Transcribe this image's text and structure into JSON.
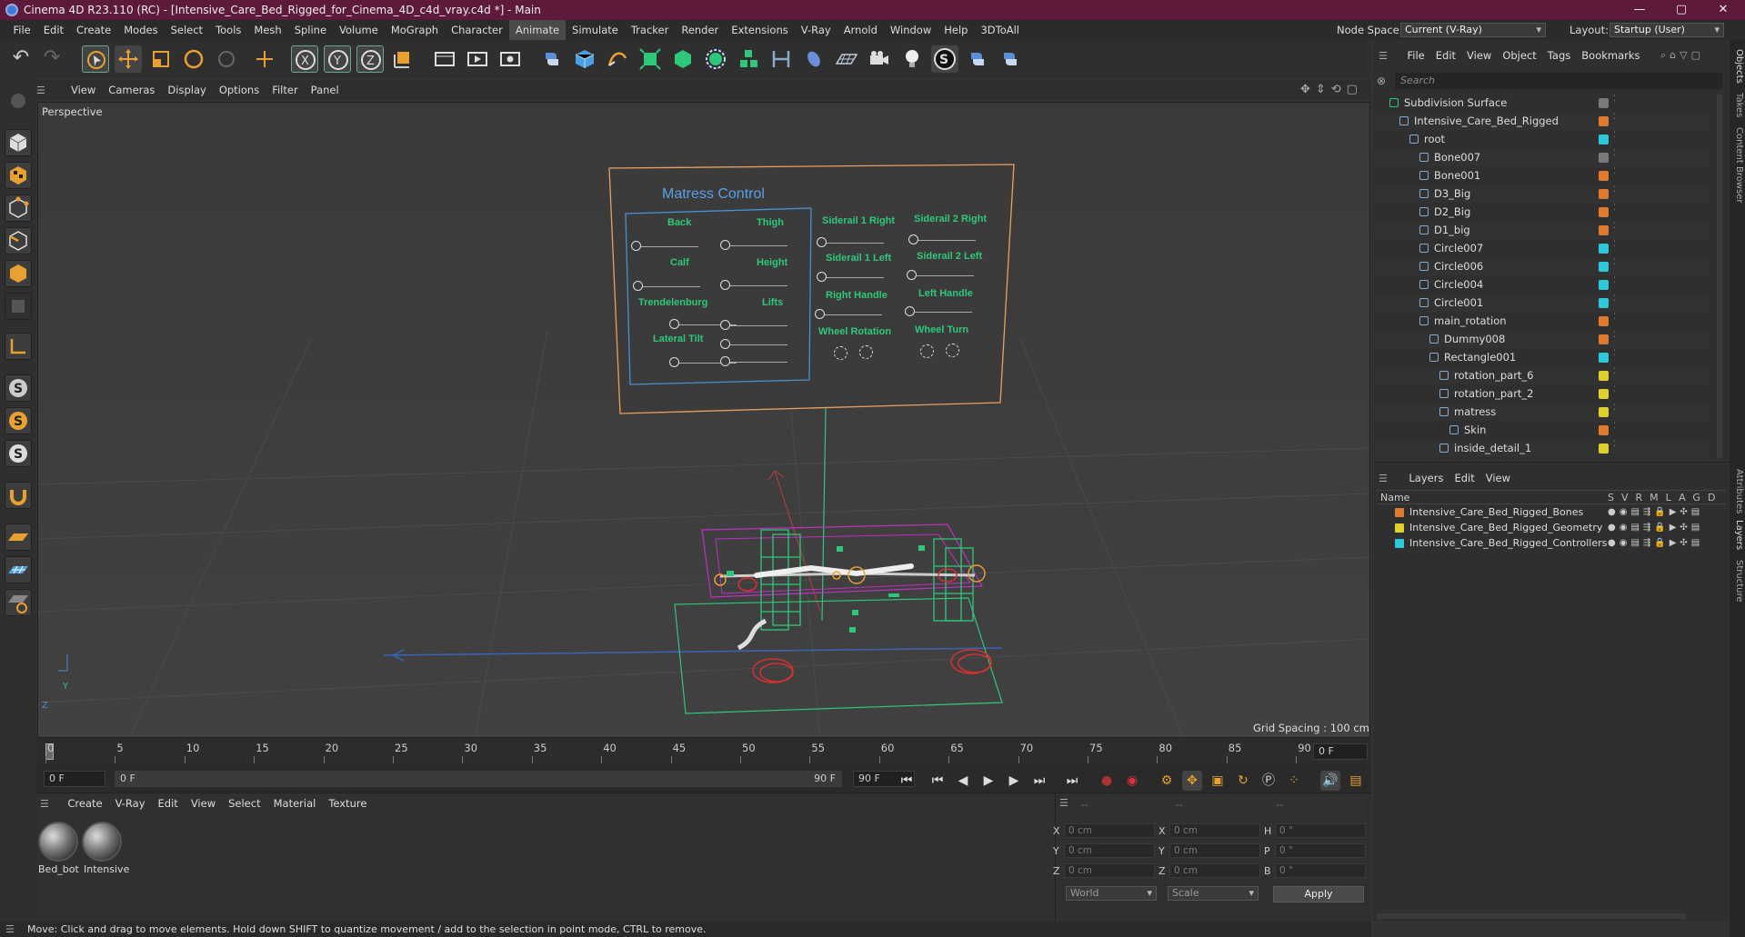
{
  "titlebar": {
    "title": "Cinema 4D R23.110 (RC) - [Intensive_Care_Bed_Rigged_for_Cinema_4D_c4d_vray.c4d *] - Main",
    "minimize": "—",
    "maximize": "▢",
    "close": "✕"
  },
  "menubar": {
    "items": [
      "File",
      "Edit",
      "Create",
      "Modes",
      "Select",
      "Tools",
      "Mesh",
      "Spline",
      "Volume",
      "MoGraph",
      "Character",
      "Animate",
      "Simulate",
      "Tracker",
      "Render",
      "Extensions",
      "V-Ray",
      "Arnold",
      "Window",
      "Help",
      "3DToAll"
    ],
    "active": "Animate",
    "node_space_label": "Node Space:",
    "node_space_value": "Current (V-Ray)",
    "layout_label": "Layout:",
    "layout_value": "Startup (User)"
  },
  "viewport": {
    "menu": [
      "View",
      "Cameras",
      "Display",
      "Options",
      "Filter",
      "Panel"
    ],
    "label": "Perspective",
    "grid_spacing": "Grid Spacing : 100 cm",
    "axis_y": "Y",
    "axis_z": "Z",
    "hud": {
      "title": "Matress Control",
      "left_sliders": [
        "Back",
        "Thigh",
        "Calf",
        "Height",
        "Trendelenburg",
        "Lifts",
        "Lateral Tilt"
      ],
      "right_sliders": [
        "Siderail 1 Right",
        "Siderail 2 Right",
        "Siderail 1 Left",
        "Siderail 2 Left",
        "Right Handle",
        "Left Handle",
        "Wheel Rotation",
        "Wheel Turn"
      ]
    }
  },
  "timeline": {
    "ticks": [
      "0",
      "5",
      "10",
      "15",
      "20",
      "25",
      "30",
      "35",
      "40",
      "45",
      "50",
      "55",
      "60",
      "65",
      "70",
      "75",
      "80",
      "85",
      "90"
    ],
    "current_frame": "0 F"
  },
  "playback": {
    "start": "0 F",
    "range_start": "0 F",
    "range_end": "90 F",
    "end": "90 F"
  },
  "materials": {
    "menu": [
      "Create",
      "V-Ray",
      "Edit",
      "View",
      "Select",
      "Material",
      "Texture"
    ],
    "items": [
      "Bed_bot",
      "Intensive"
    ]
  },
  "coordinates": {
    "headers": [
      "--",
      "--",
      "--"
    ],
    "rows": [
      {
        "a": "X",
        "av": "0 cm",
        "b": "X",
        "bv": "0 cm",
        "c": "H",
        "cv": "0 °"
      },
      {
        "a": "Y",
        "av": "0 cm",
        "b": "Y",
        "bv": "0 cm",
        "c": "P",
        "cv": "0 °"
      },
      {
        "a": "Z",
        "av": "0 cm",
        "b": "Z",
        "bv": "0 cm",
        "c": "B",
        "cv": "0 °"
      }
    ],
    "space": "World",
    "mode": "Scale",
    "apply": "Apply"
  },
  "status": "Move: Click and drag to move elements. Hold down SHIFT to quantize movement / add to the selection in point mode, CTRL to remove.",
  "objects": {
    "menu": [
      "File",
      "Edit",
      "View",
      "Object",
      "Tags",
      "Bookmarks"
    ],
    "search_placeholder": "Search",
    "rows": [
      {
        "name": "Subdivision Surface",
        "indent": 0,
        "color": "#7a7a7a"
      },
      {
        "name": "Intensive_Care_Bed_Rigged",
        "indent": 1,
        "color": "#e07a2e"
      },
      {
        "name": "root",
        "indent": 2,
        "color": "#2ec8d8"
      },
      {
        "name": "Bone007",
        "indent": 3,
        "color": "#7a7a7a"
      },
      {
        "name": "Bone001",
        "indent": 3,
        "color": "#e07a2e"
      },
      {
        "name": "D3_Big",
        "indent": 3,
        "color": "#e07a2e"
      },
      {
        "name": "D2_Big",
        "indent": 3,
        "color": "#e07a2e"
      },
      {
        "name": "D1_big",
        "indent": 3,
        "color": "#e07a2e"
      },
      {
        "name": "Circle007",
        "indent": 3,
        "color": "#2ec8d8"
      },
      {
        "name": "Circle006",
        "indent": 3,
        "color": "#2ec8d8"
      },
      {
        "name": "Circle004",
        "indent": 3,
        "color": "#2ec8d8"
      },
      {
        "name": "Circle001",
        "indent": 3,
        "color": "#2ec8d8"
      },
      {
        "name": "main_rotation",
        "indent": 3,
        "color": "#e07a2e"
      },
      {
        "name": "Dummy008",
        "indent": 4,
        "color": "#e07a2e"
      },
      {
        "name": "Rectangle001",
        "indent": 4,
        "color": "#2ec8d8"
      },
      {
        "name": "rotation_part_6",
        "indent": 5,
        "color": "#e0d02e"
      },
      {
        "name": "rotation_part_2",
        "indent": 5,
        "color": "#e0d02e"
      },
      {
        "name": "matress",
        "indent": 5,
        "color": "#e0d02e"
      },
      {
        "name": "Skin",
        "indent": 6,
        "color": "#e07a2e"
      },
      {
        "name": "inside_detail_1",
        "indent": 5,
        "color": "#e0d02e"
      }
    ]
  },
  "layers": {
    "menu": [
      "Layers",
      "Edit",
      "View"
    ],
    "header_name": "Name",
    "header_cols": [
      "S",
      "V",
      "R",
      "M",
      "L",
      "A",
      "G",
      "D"
    ],
    "rows": [
      {
        "name": "Intensive_Care_Bed_Rigged_Bones",
        "color": "#e07a2e"
      },
      {
        "name": "Intensive_Care_Bed_Rigged_Geometry",
        "color": "#e0d02e"
      },
      {
        "name": "Intensive_Care_Bed_Rigged_Controllers",
        "color": "#2ec8d8"
      }
    ]
  },
  "side_tabs": [
    "Objects",
    "Takes",
    "Content Browser",
    "Attributes",
    "Layers",
    "Structure"
  ]
}
